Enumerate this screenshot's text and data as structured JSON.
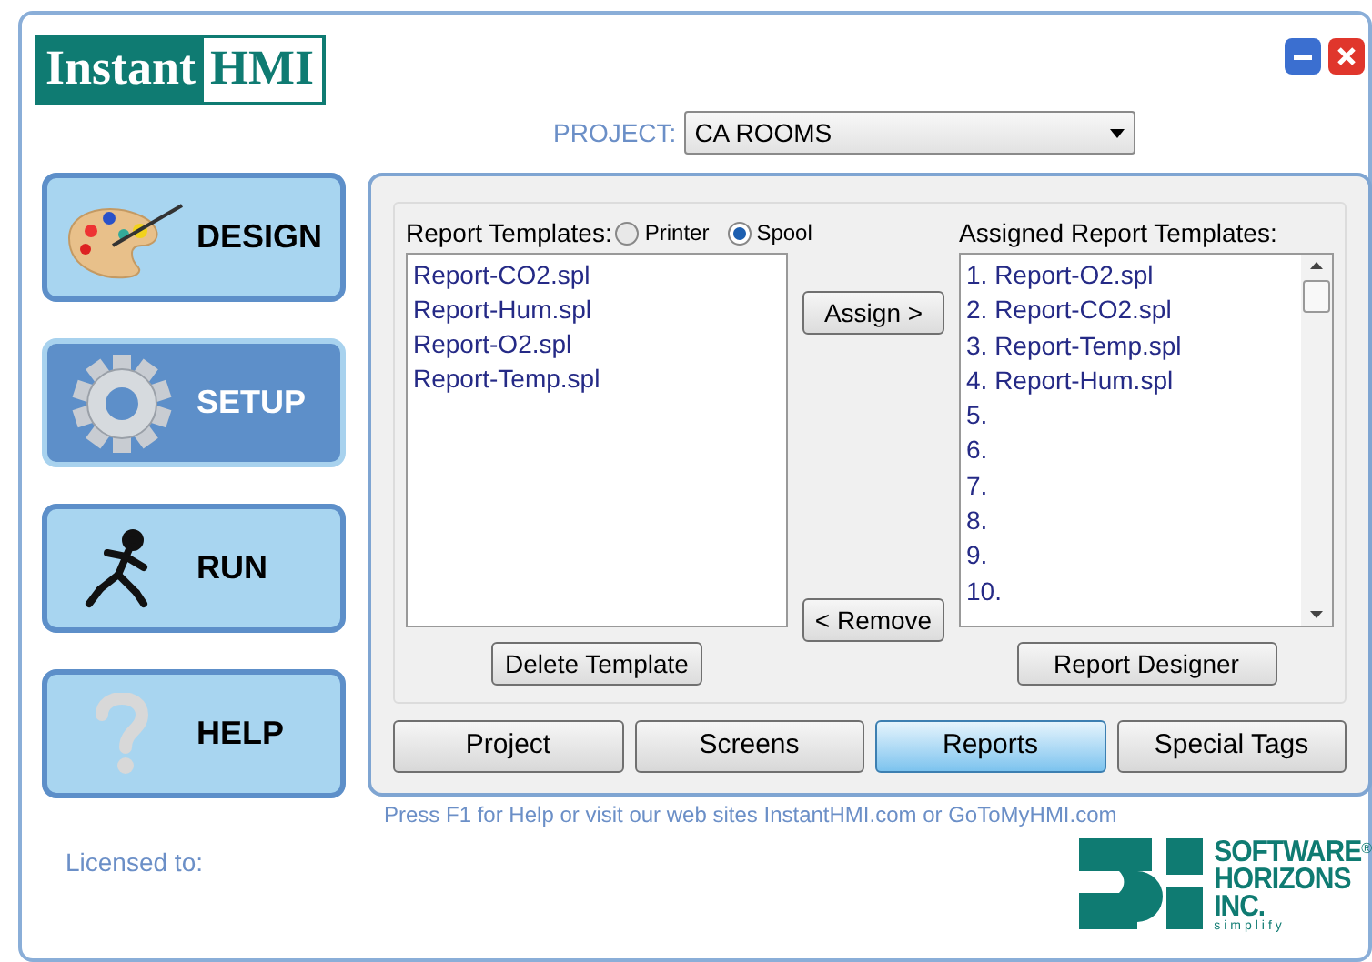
{
  "logo": {
    "word_1": "Instant",
    "word_2": "HMI"
  },
  "window_controls": [
    {
      "kind": "minimize"
    },
    {
      "kind": "close"
    }
  ],
  "project": {
    "label": "PROJECT:",
    "value": "CA ROOMS"
  },
  "nav": [
    {
      "kind": "design",
      "label": "DESIGN",
      "selected": false
    },
    {
      "kind": "setup",
      "label": "SETUP",
      "selected": true
    },
    {
      "kind": "run",
      "label": "RUN",
      "selected": false
    },
    {
      "kind": "help",
      "label": "HELP",
      "selected": false
    }
  ],
  "templates": {
    "label": "Report Templates:",
    "output": [
      {
        "label": "Printer",
        "selected": false
      },
      {
        "label": "Spool",
        "selected": true
      }
    ],
    "items": [
      "Report-CO2.spl",
      "Report-Hum.spl",
      "Report-O2.spl",
      "Report-Temp.spl"
    ]
  },
  "assign_button": "Assign >",
  "remove_button": "< Remove",
  "assigned": {
    "label": "Assigned Report Templates:",
    "items": [
      "1. Report-O2.spl",
      "2. Report-CO2.spl",
      "3. Report-Temp.spl",
      "4. Report-Hum.spl",
      "5.",
      "6.",
      "7.",
      "8.",
      "9.",
      "10."
    ]
  },
  "delete_button": "Delete Template",
  "designer_button": "Report Designer",
  "tabs": [
    {
      "label": "Project",
      "selected": false
    },
    {
      "label": "Screens",
      "selected": false
    },
    {
      "label": "Reports",
      "selected": true
    },
    {
      "label": "Special Tags",
      "selected": false
    }
  ],
  "help_text": "Press F1 for Help or visit our web sites InstantHMI.com or GoToMyHMI.com",
  "licensed_label": "Licensed to:",
  "company_logo": {
    "lines": [
      "SOFTWARE",
      "HORIZONS",
      "INC."
    ],
    "mark": "®",
    "tagline": "simplify"
  }
}
